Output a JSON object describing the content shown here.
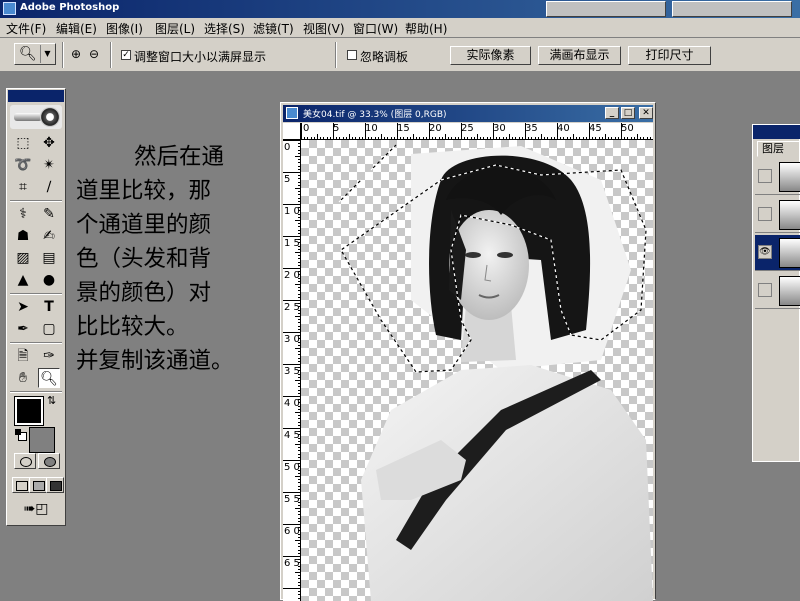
{
  "app": {
    "title": "Adobe Photoshop"
  },
  "menu": [
    {
      "label": "文件(F)"
    },
    {
      "label": "编辑(E)"
    },
    {
      "label": "图像(I)"
    },
    {
      "label": "图层(L)"
    },
    {
      "label": "选择(S)"
    },
    {
      "label": "滤镜(T)"
    },
    {
      "label": "视图(V)"
    },
    {
      "label": "窗口(W)"
    },
    {
      "label": "帮助(H)"
    }
  ],
  "options": {
    "resize_windows": {
      "label": "调整窗口大小以满屏显示",
      "checked": true
    },
    "ignore_palettes": {
      "label": "忽略调板",
      "checked": false
    },
    "actual_pixels": "实际像素",
    "fit_on_screen": "满画布显示",
    "print_size": "打印尺寸"
  },
  "tutorial": {
    "lines": [
      "然后在通",
      "道里比较，那",
      "个通道里的颜",
      "色（头发和背",
      "景的颜色）对",
      "比比较大。",
      "并复制该通道。"
    ]
  },
  "document": {
    "title": "美女04.tif @ 33.3% (图层 0,RGB)",
    "ruler_h": [
      "0",
      "5",
      "10",
      "15",
      "20",
      "25",
      "30",
      "35",
      "40",
      "45",
      "50"
    ],
    "ruler_v": [
      "0",
      "5",
      "1 0",
      "1 5",
      "2 0",
      "2 5",
      "3 0",
      "3 5",
      "4 0",
      "4 5",
      "5 0",
      "5 5",
      "6 0",
      "6 5"
    ]
  },
  "layers_panel": {
    "tab": "图层",
    "rows": [
      {
        "visible": false
      },
      {
        "visible": false
      },
      {
        "visible": true
      },
      {
        "visible": false
      }
    ],
    "selected_index": 2
  },
  "colors": {
    "foreground": "#000000",
    "background": "#808080",
    "title_bar": "#0a246a"
  }
}
